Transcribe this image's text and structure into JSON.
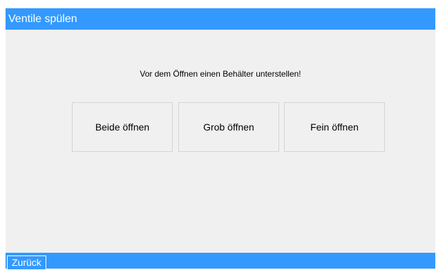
{
  "header": {
    "title": "Ventile spülen"
  },
  "main": {
    "instruction": "Vor dem Öffnen einen Behälter unterstellen!",
    "buttons": {
      "open_both": "Beide öffnen",
      "open_coarse": "Grob öffnen",
      "open_fine": "Fein öffnen"
    }
  },
  "footer": {
    "back_label": "Zurück"
  },
  "colors": {
    "accent": "#3399ff",
    "background": "#f0f0f0",
    "button_border": "#d4d4d4",
    "bar_text": "#ffffff"
  }
}
